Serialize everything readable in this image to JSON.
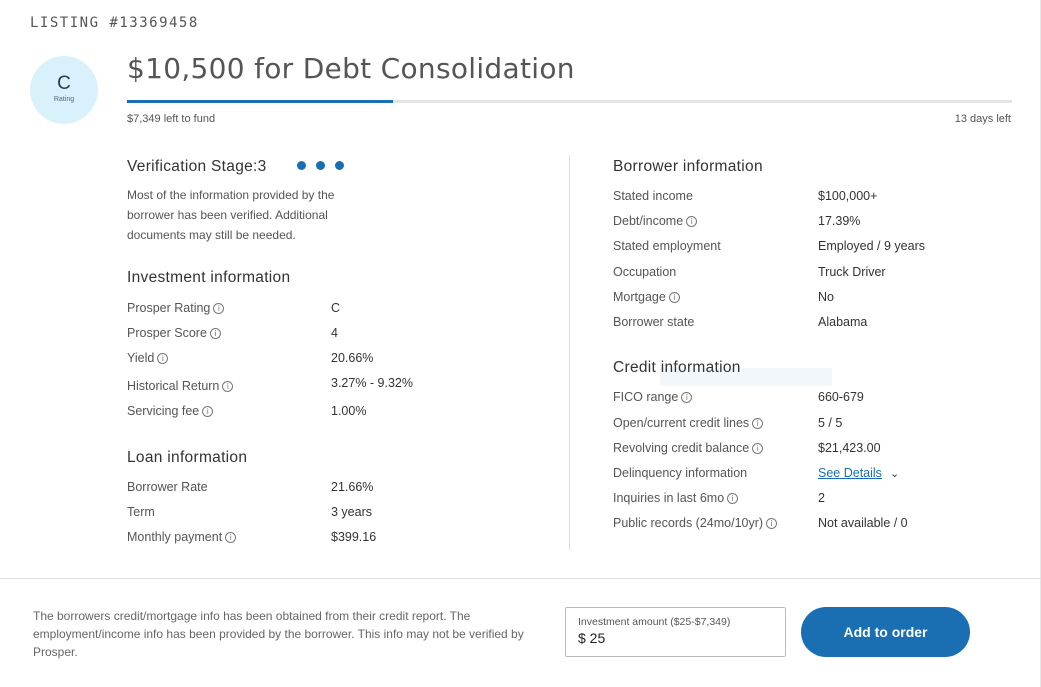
{
  "listing": {
    "id_label": "LISTING #13369458"
  },
  "rating": {
    "grade": "C",
    "label": "Rating"
  },
  "header": {
    "title": "$10,500 for Debt Consolidation",
    "left_to_fund": "$7,349 left to fund",
    "days_left": "13 days left",
    "funded_fraction": 0.3
  },
  "verification": {
    "title": "Verification Stage:3",
    "text": "Most of the information provided by the borrower has been verified. Additional documents may still be needed."
  },
  "investment": {
    "title": "Investment information",
    "rows": [
      {
        "label": "Prosper Rating",
        "value": "C"
      },
      {
        "label": "Prosper Score",
        "value": "4"
      },
      {
        "label": "Yield",
        "value": "20.66%"
      },
      {
        "label": "Historical Return",
        "value": "3.27% - 9.32%"
      },
      {
        "label": "Servicing fee",
        "value": "1.00%"
      }
    ]
  },
  "loan": {
    "title": "Loan information",
    "rows": [
      {
        "label": "Borrower Rate",
        "value": "21.66%"
      },
      {
        "label": "Term",
        "value": "3 years"
      },
      {
        "label": "Monthly payment",
        "value": "$399.16"
      }
    ]
  },
  "borrower": {
    "title": "Borrower information",
    "rows": [
      {
        "label": "Stated income",
        "value": "$100,000+"
      },
      {
        "label": "Debt/income",
        "value": "17.39%"
      },
      {
        "label": "Stated employment",
        "value": "Employed / 9 years"
      },
      {
        "label": "Occupation",
        "value": "Truck Driver"
      },
      {
        "label": "Mortgage",
        "value": "No"
      },
      {
        "label": "Borrower state",
        "value": "Alabama"
      }
    ]
  },
  "credit": {
    "title": "Credit information",
    "rows": [
      {
        "label": "FICO range",
        "value": "660-679"
      },
      {
        "label": "Open/current credit lines",
        "value": "5 / 5"
      },
      {
        "label": "Revolving credit balance",
        "value": "$21,423.00"
      },
      {
        "label": "Delinquency information",
        "value": "See Details"
      },
      {
        "label": "Inquiries in last 6mo",
        "value": "2"
      },
      {
        "label": "Public records (24mo/10yr)",
        "value": "Not available / 0"
      }
    ]
  },
  "footer": {
    "disclaimer": "The borrowers credit/mortgage info has been obtained from their credit report. The employment/income info has been provided by the borrower. This info may not be verified by Prosper.",
    "investment_label": "Investment amount ($25-$7,349)",
    "investment_value": "$ 25",
    "add_button": "Add to order"
  },
  "icons": {
    "info": "i"
  },
  "colors": {
    "accent": "#1a6fb2",
    "rating_bg": "#d9f1fb"
  }
}
